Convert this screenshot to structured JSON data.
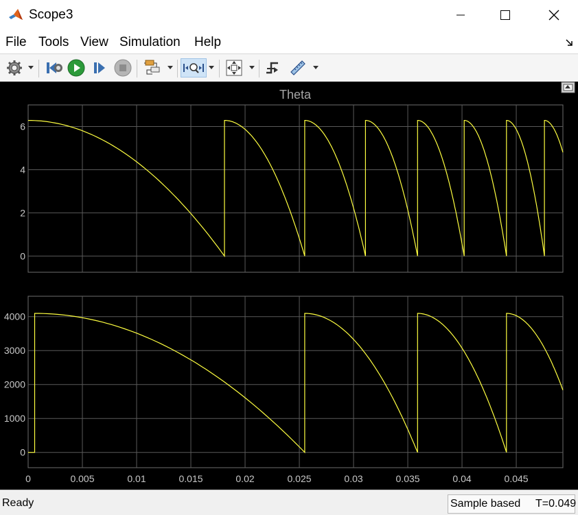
{
  "window": {
    "title": "Scope3"
  },
  "menu": [
    "File",
    "Tools",
    "View",
    "Simulation",
    "Help"
  ],
  "toolbar": {
    "buttons": [
      {
        "name": "configuration-properties-button",
        "icon": "gear-icon"
      },
      {
        "name": "step-back-button",
        "icon": "step-back-icon"
      },
      {
        "name": "run-button",
        "icon": "play-icon"
      },
      {
        "name": "step-forward-button",
        "icon": "step-forward-icon"
      },
      {
        "name": "stop-button",
        "icon": "stop-icon"
      },
      {
        "name": "highlight-block-button",
        "icon": "block-diagram-icon"
      },
      {
        "name": "zoom-button",
        "icon": "zoom-axes-icon"
      },
      {
        "name": "autoscale-button",
        "icon": "autoscale-icon"
      },
      {
        "name": "triggers-button",
        "icon": "trigger-icon"
      },
      {
        "name": "measurements-button",
        "icon": "ruler-icon"
      }
    ]
  },
  "colors": {
    "trace": "#ffff40",
    "axes_bg": "#000000",
    "grid": "#5a5a5a",
    "tick_text": "#c8c8c8"
  },
  "chart_data": [
    {
      "type": "line",
      "title": "Theta",
      "xlim": [
        0,
        0.0493
      ],
      "ylim": [
        -0.75,
        7.0
      ],
      "xticks": [
        0,
        0.005,
        0.01,
        0.015,
        0.02,
        0.025,
        0.03,
        0.035,
        0.04,
        0.045
      ],
      "yticks": [
        0,
        2,
        4,
        6
      ],
      "ytick_labels": [
        "0",
        "2",
        "4",
        "6"
      ],
      "grid": true,
      "series": [
        {
          "segments": [
            {
              "t0": 0.0,
              "t1": 0.0181,
              "ymax": 6.2832
            },
            {
              "t0": 0.0181,
              "t1": 0.0255,
              "ymax": 6.2832
            },
            {
              "t0": 0.0255,
              "t1": 0.0311,
              "ymax": 6.2832
            },
            {
              "t0": 0.0311,
              "t1": 0.0359,
              "ymax": 6.2832
            },
            {
              "t0": 0.0359,
              "t1": 0.0402,
              "ymax": 6.2832
            },
            {
              "t0": 0.0402,
              "t1": 0.0441,
              "ymax": 6.2832
            },
            {
              "t0": 0.0441,
              "t1": 0.0476,
              "ymax": 6.2832
            },
            {
              "t0": 0.0476,
              "t1": 0.0511,
              "ymax": 6.2832
            }
          ]
        }
      ]
    },
    {
      "type": "line",
      "title": "",
      "xlim": [
        0,
        0.0493
      ],
      "ylim": [
        -450,
        4600
      ],
      "xticks": [
        0,
        0.005,
        0.01,
        0.015,
        0.02,
        0.025,
        0.03,
        0.035,
        0.04,
        0.045
      ],
      "xtick_labels": [
        "0",
        "0.005",
        "0.01",
        "0.015",
        "0.02",
        "0.025",
        "0.03",
        "0.035",
        "0.04",
        "0.045"
      ],
      "yticks": [
        0,
        1000,
        2000,
        3000,
        4000
      ],
      "ytick_labels": [
        "0",
        "1000",
        "2000",
        "3000",
        "4000"
      ],
      "grid": true,
      "series": [
        {
          "initial_zero_until": 0.0006,
          "segments": [
            {
              "t0": 0.0006,
              "t1": 0.0255,
              "ymax": 4096
            },
            {
              "t0": 0.0255,
              "t1": 0.0359,
              "ymax": 4096
            },
            {
              "t0": 0.0359,
              "t1": 0.0441,
              "ymax": 4096
            },
            {
              "t0": 0.0441,
              "t1": 0.0511,
              "ymax": 4096
            }
          ]
        }
      ]
    }
  ],
  "status": {
    "left": "Ready",
    "sample": "Sample based",
    "time": "T=0.049"
  }
}
